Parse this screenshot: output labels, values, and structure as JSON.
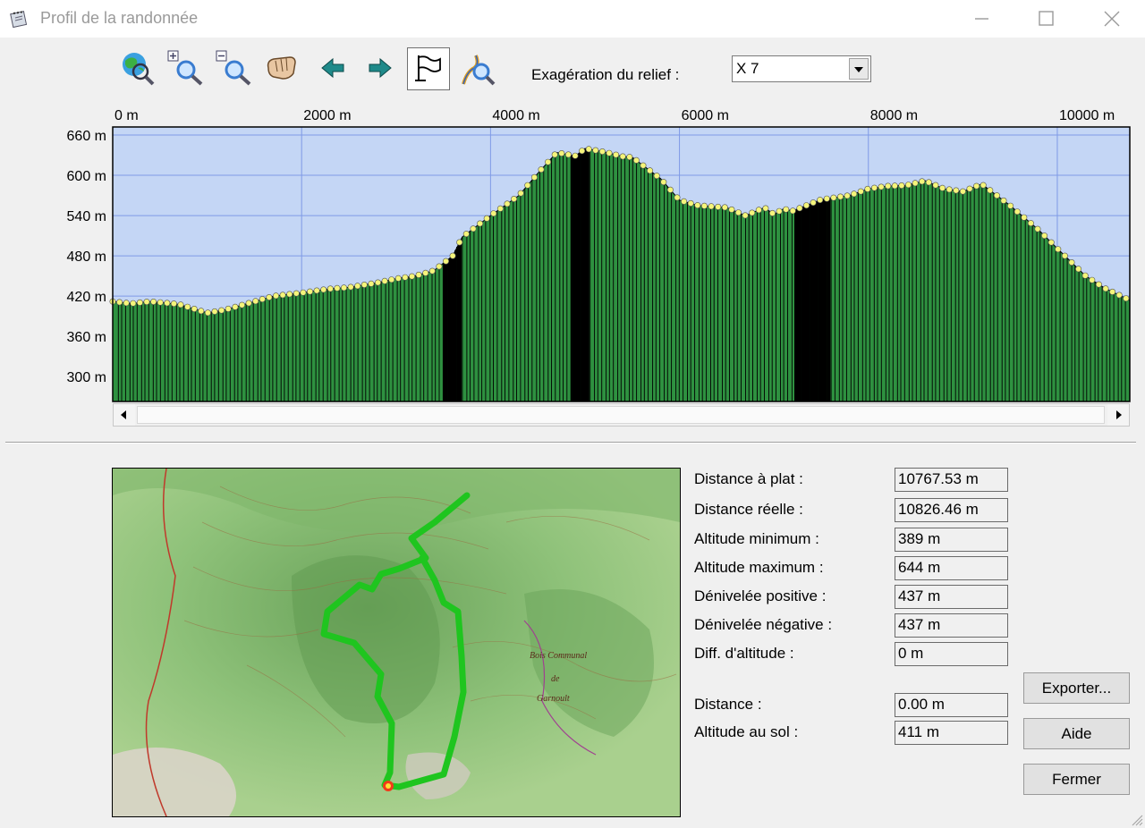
{
  "window": {
    "title": "Profil de la randonnée"
  },
  "toolbar": {
    "icons": [
      "globe-search-icon",
      "zoom-in-icon",
      "zoom-out-icon",
      "hand-pan-icon",
      "arrow-left-icon",
      "arrow-right-icon",
      "flag-icon",
      "path-search-icon"
    ],
    "exaggeration_label": "Exagération du relief :",
    "exaggeration_value": "X 7"
  },
  "chart_data": {
    "type": "area",
    "xlabel": "",
    "ylabel": "",
    "x_ticks": [
      "0 m",
      "2000 m",
      "4000 m",
      "6000 m",
      "8000 m",
      "10000 m"
    ],
    "y_ticks": [
      "660 m",
      "600 m",
      "540 m",
      "480 m",
      "420 m",
      "360 m",
      "300 m"
    ],
    "xlim": [
      0,
      10767.53
    ],
    "ylim": [
      263,
      672
    ],
    "grid": true,
    "colors": {
      "fill": "#2e9140",
      "dense": "#000000",
      "sky": "#c4d6f5",
      "marker": "#f5f57a",
      "grid": "#7f9ae6"
    },
    "x": [
      0,
      200,
      400,
      700,
      1000,
      1200,
      1500,
      1700,
      2000,
      2300,
      2500,
      2800,
      3000,
      3200,
      3400,
      3600,
      3700,
      4000,
      4300,
      4500,
      4700,
      4900,
      5000,
      5200,
      5400,
      5500,
      5800,
      6000,
      6200,
      6500,
      6700,
      6900,
      7000,
      7100,
      7200,
      7500,
      7800,
      8000,
      8200,
      8400,
      8600,
      8800,
      9000,
      9200,
      9500,
      9800,
      10000,
      10300,
      10500,
      10767
    ],
    "y": [
      412,
      409,
      412,
      408,
      395,
      400,
      412,
      420,
      425,
      431,
      433,
      440,
      446,
      450,
      458,
      480,
      508,
      540,
      570,
      603,
      634,
      629,
      640,
      635,
      628,
      627,
      595,
      563,
      555,
      552,
      540,
      552,
      542,
      550,
      547,
      564,
      570,
      580,
      584,
      585,
      592,
      580,
      576,
      587,
      555,
      519,
      491,
      450,
      432,
      414
    ]
  },
  "stats": [
    {
      "label": "Distance à plat :",
      "value": "10767.53 m"
    },
    {
      "label": "Distance réelle :",
      "value": "10826.46 m"
    },
    {
      "label": "Altitude minimum :",
      "value": "389 m"
    },
    {
      "label": "Altitude maximum :",
      "value": "644 m"
    },
    {
      "label": "Dénivelée positive :",
      "value": "437 m"
    },
    {
      "label": "Dénivelée négative :",
      "value": "437 m"
    },
    {
      "label": "Diff. d'altitude :",
      "value": "0 m"
    }
  ],
  "cursor": [
    {
      "label": "Distance :",
      "value": "0.00 m"
    },
    {
      "label": "Altitude au sol :",
      "value": "411 m"
    }
  ],
  "map_labels": [
    "Bois Communal",
    "de",
    "Garnoult"
  ],
  "buttons": {
    "export": "Exporter...",
    "help": "Aide",
    "close": "Fermer"
  }
}
